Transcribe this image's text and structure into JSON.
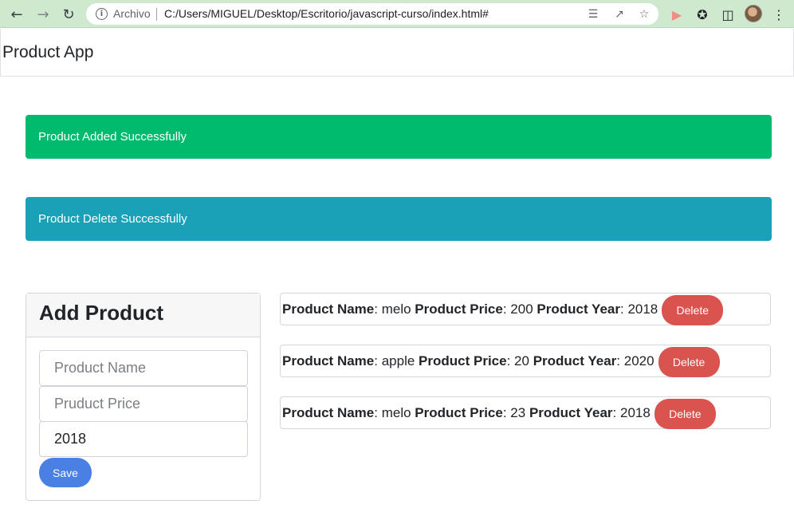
{
  "browser": {
    "back_icon": "arrow-left-icon",
    "forward_icon": "arrow-right-icon",
    "reload_icon": "reload-icon",
    "site_info": "Archivo",
    "url": "C:/Users/MIGUEL/Desktop/Escritorio/javascript-curso/index.html#"
  },
  "app": {
    "brand": "Product App"
  },
  "alerts": {
    "success": "Product Added Successfully",
    "info": "Product Delete Successfully",
    "success_color": "#00ba6e",
    "info_color": "#1aa1b8"
  },
  "form": {
    "title": "Add Product",
    "name_placeholder": "Product Name",
    "price_placeholder": "Pruduct Price",
    "year_value": "2018",
    "save_label": "Save"
  },
  "products": [
    {
      "name_label": "Product Name",
      "name": "melo",
      "price_label": "Product Price",
      "price": "200",
      "year_label": "Product Year",
      "year": "2018",
      "delete_label": "Delete"
    },
    {
      "name_label": "Product Name",
      "name": "apple",
      "price_label": "Product Price",
      "price": "20",
      "year_label": "Product Year",
      "year": "2020",
      "delete_label": "Delete"
    },
    {
      "name_label": "Product Name",
      "name": "melo",
      "price_label": "Product Price",
      "price": "23",
      "year_label": "Product Year",
      "year": "2018",
      "delete_label": "Delete"
    }
  ],
  "colors": {
    "save_button": "#4a7fe3",
    "delete_button": "#d9534f"
  }
}
